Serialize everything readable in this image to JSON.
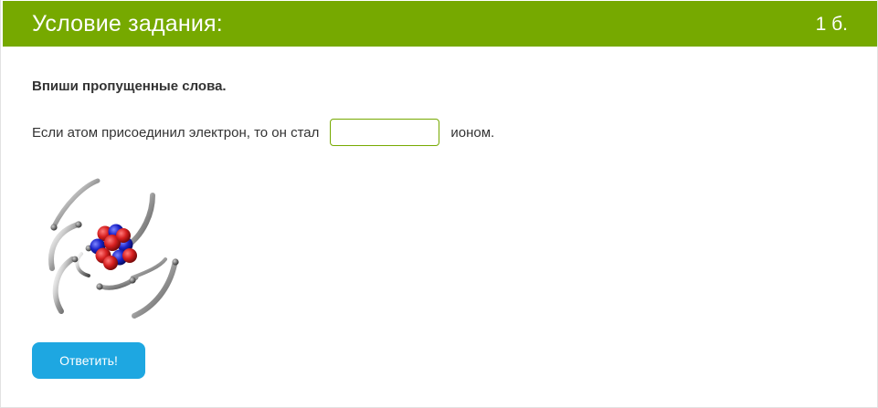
{
  "header": {
    "title": "Условие задания:",
    "points": "1 б."
  },
  "task": {
    "instruction": "Впиши пропущенные слова.",
    "sentence_before": "Если атом присоединил электрон, то он стал",
    "answer_value": "",
    "sentence_after": "ионом."
  },
  "image": {
    "icon": "atom-icon",
    "proton_color": "#d61f1f",
    "neutron_color": "#1a22c8"
  },
  "actions": {
    "submit_label": "Ответить!"
  },
  "colors": {
    "header_bg": "#76a900",
    "button_bg": "#1ea7e1",
    "input_border": "#76a900"
  }
}
